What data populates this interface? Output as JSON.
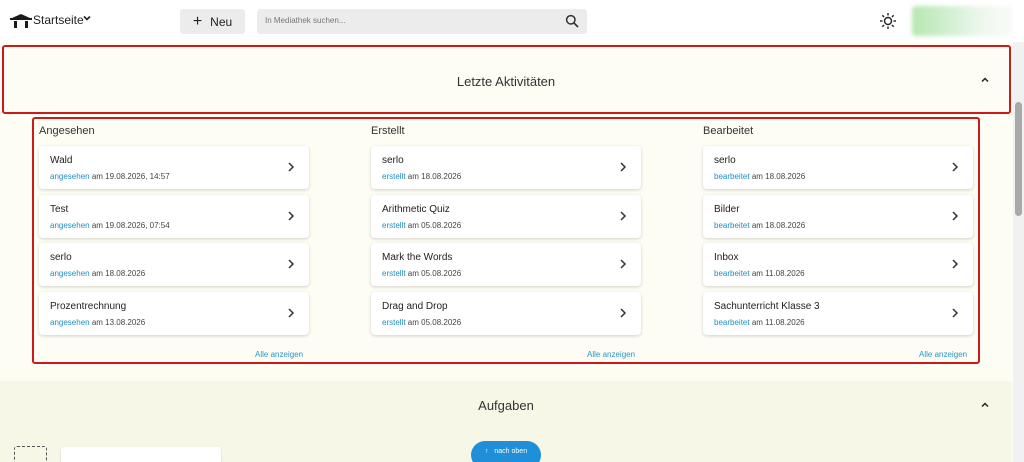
{
  "topbar": {
    "home_label": "Startseite",
    "new_label": "Neu",
    "search_placeholder": "In Mediathek suchen..."
  },
  "recent": {
    "title": "Letzte Aktivitäten",
    "columns": [
      {
        "title": "Angesehen",
        "show_all": "Alle anzeigen",
        "items": [
          {
            "title": "Wald",
            "verb": "angesehen",
            "rest": " am 19.08.2026, 14:57"
          },
          {
            "title": "Test",
            "verb": "angesehen",
            "rest": " am 19.08.2026, 07:54"
          },
          {
            "title": "serlo",
            "verb": "angesehen",
            "rest": " am 18.08.2026"
          },
          {
            "title": "Prozentrechnung",
            "verb": "angesehen",
            "rest": " am 13.08.2026"
          }
        ]
      },
      {
        "title": "Erstellt",
        "show_all": "Alle anzeigen",
        "items": [
          {
            "title": "serlo",
            "verb": "erstellt",
            "rest": " am 18.08.2026"
          },
          {
            "title": "Arithmetic Quiz",
            "verb": "erstellt",
            "rest": " am 05.08.2026"
          },
          {
            "title": "Mark the Words",
            "verb": "erstellt",
            "rest": " am 05.08.2026"
          },
          {
            "title": "Drag and Drop",
            "verb": "erstellt",
            "rest": " am 05.08.2026"
          }
        ]
      },
      {
        "title": "Bearbeitet",
        "show_all": "Alle anzeigen",
        "items": [
          {
            "title": "serlo",
            "verb": "bearbeitet",
            "rest": " am 18.08.2026"
          },
          {
            "title": "Bilder",
            "verb": "bearbeitet",
            "rest": " am 18.08.2026"
          },
          {
            "title": "Inbox",
            "verb": "bearbeitet",
            "rest": " am 11.08.2026"
          },
          {
            "title": "Sachunterricht Klasse 3",
            "verb": "bearbeitet",
            "rest": " am 11.08.2026"
          }
        ]
      }
    ]
  },
  "tasks": {
    "title": "Aufgaben"
  },
  "to_top_label": "nach oben",
  "colors": {
    "accent": "#1e8fd8",
    "link": "#2a96cf",
    "highlight": "#cc1a1a"
  }
}
